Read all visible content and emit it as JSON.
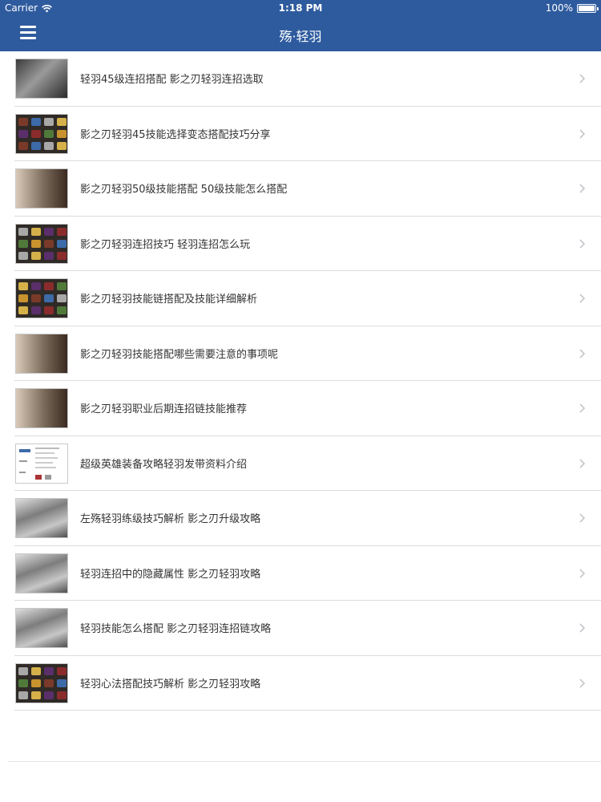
{
  "status_bar": {
    "carrier": "Carrier",
    "time": "1:18 PM",
    "battery": "100%"
  },
  "nav": {
    "title": "殇·轻羽"
  },
  "colors": {
    "nav_background": "#2e5b9e",
    "separator": "#dcdcdc",
    "text": "#333333"
  },
  "articles": [
    {
      "title": "轻羽45级连招搭配 影之刃轻羽连招选取",
      "thumb": "dark"
    },
    {
      "title": "影之刃轻羽45技能选择变态搭配技巧分享",
      "thumb": "grid"
    },
    {
      "title": "影之刃轻羽50级技能搭配 50级技能怎么搭配",
      "thumb": "portrait"
    },
    {
      "title": "影之刃轻羽连招技巧 轻羽连招怎么玩",
      "thumb": "grid"
    },
    {
      "title": "影之刃轻羽技能链搭配及技能详细解析",
      "thumb": "grid"
    },
    {
      "title": "影之刃轻羽技能搭配哪些需要注意的事项呢",
      "thumb": "portrait"
    },
    {
      "title": "影之刃轻羽职业后期连招链技能推荐",
      "thumb": "portrait"
    },
    {
      "title": "超级英雄装备攻略轻羽发带资料介绍",
      "thumb": "doc"
    },
    {
      "title": "左殇轻羽练级技巧解析 影之刃升级攻略",
      "thumb": "gray"
    },
    {
      "title": "轻羽连招中的隐藏属性 影之刃轻羽攻略",
      "thumb": "gray"
    },
    {
      "title": "轻羽技能怎么搭配 影之刃轻羽连招链攻略",
      "thumb": "gray"
    },
    {
      "title": "轻羽心法搭配技巧解析 影之刃轻羽攻略",
      "thumb": "grid"
    }
  ]
}
